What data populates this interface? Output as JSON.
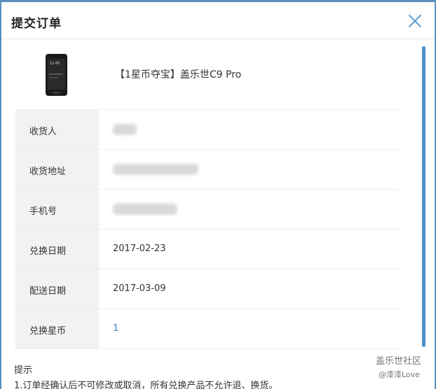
{
  "dialog": {
    "title": "提交订单",
    "close_icon": "close-icon"
  },
  "product": {
    "name": "【1星币夺宝】盖乐世C9 Pro",
    "phone_time": "12:45"
  },
  "info_rows": [
    {
      "label": "收货人",
      "value": ""
    },
    {
      "label": "收货地址",
      "value": ""
    },
    {
      "label": "手机号",
      "value": ""
    },
    {
      "label": "兑换日期",
      "value": "2017-02-23"
    },
    {
      "label": "配送日期",
      "value": "2017-03-09"
    },
    {
      "label": "兑换星币",
      "value": "1"
    }
  ],
  "tips": {
    "title": "提示",
    "line1": "1.订单经确认后不可修改或取消，所有兑换产品不允许退、换货。"
  },
  "watermark": {
    "line1": "盖乐世社区",
    "line2": "@漆漆Love"
  },
  "colors": {
    "accent": "#5a8fc0",
    "link": "#3a7fc6",
    "label_bg": "#f2f2f2"
  }
}
